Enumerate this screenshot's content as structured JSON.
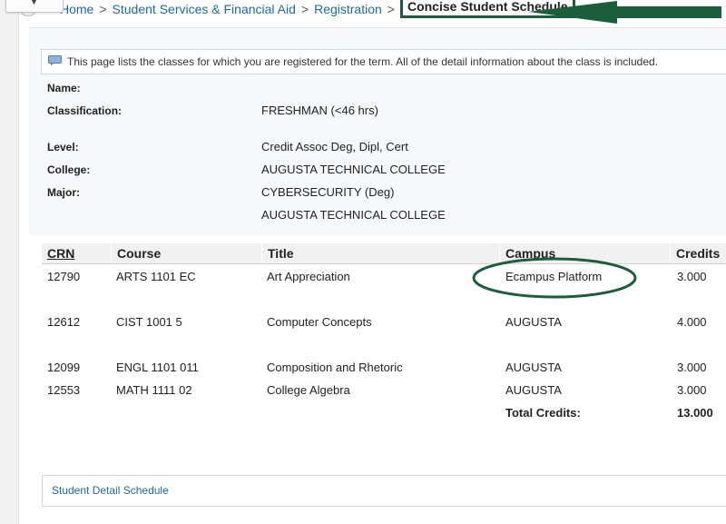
{
  "breadcrumb": {
    "items": [
      "Home",
      "Student Services & Financial Aid",
      "Registration"
    ],
    "separator": ">",
    "current": "Concise Student Schedule"
  },
  "info": {
    "text": "This page lists the classes for which you are registered for the term. All of the detail information about the class is included."
  },
  "student": {
    "name_label": "Name:",
    "name_value": "",
    "classification_label": "Classification:",
    "classification_value": "FRESHMAN (<46 hrs)",
    "level_label": "Level:",
    "level_value": "Credit Assoc Deg, Dipl, Cert",
    "college_label": "College:",
    "college_value": "AUGUSTA TECHNICAL COLLEGE",
    "major_label": "Major:",
    "major_value": "CYBERSECURITY (Deg)",
    "major_college_value": "AUGUSTA TECHNICAL COLLEGE"
  },
  "schedule": {
    "headers": [
      "CRN",
      "Course",
      "Title",
      "Campus",
      "Credits"
    ],
    "rows": [
      {
        "crn": "12790",
        "course": "ARTS 1101 EC",
        "title": "Art Appreciation",
        "campus": "Ecampus Platform",
        "credits": "3.000"
      },
      {
        "crn": "12612",
        "course": "CIST 1001 5",
        "title": "Computer Concepts",
        "campus": "AUGUSTA",
        "credits": "4.000"
      },
      {
        "crn": "12099",
        "course": "ENGL 1101 011",
        "title": "Composition and Rhetoric",
        "campus": "AUGUSTA",
        "credits": "3.000"
      },
      {
        "crn": "12553",
        "course": "MATH 1111 02",
        "title": "College Algebra",
        "campus": "AUGUSTA",
        "credits": "3.000"
      }
    ],
    "total_label": "Total Credits:",
    "total_value": "13.000"
  },
  "footer": {
    "detail_link": "Student Detail Schedule"
  },
  "colors": {
    "link": "#1c6aa6",
    "annotation_green": "#1b5e3b"
  },
  "icons": {
    "info": "speech-bubble-icon",
    "back": "back-circle-icon",
    "dropdown": "chevron-down-icon"
  }
}
